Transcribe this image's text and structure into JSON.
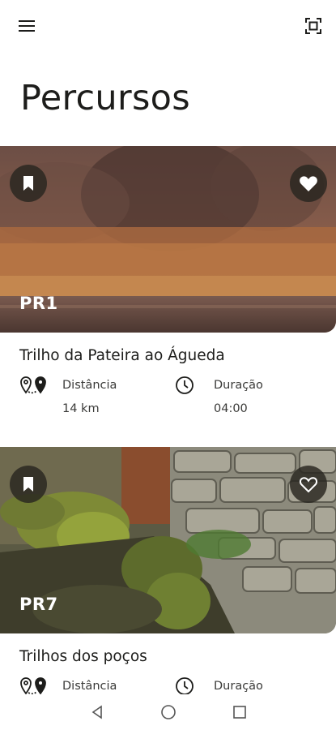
{
  "header": {
    "menu_icon": "hamburger-menu-icon",
    "scan_icon": "scan-frame-icon"
  },
  "page": {
    "title": "Percursos"
  },
  "routes": [
    {
      "code": "PR1",
      "name": "Trilho da Pateira ao Águeda",
      "distance_label": "Distância",
      "distance_value": "14 km",
      "duration_label": "Duração",
      "duration_value": "04:00",
      "favorite": true,
      "image": "wetland-reeds-tree-photo"
    },
    {
      "code": "PR7",
      "name": "Trilhos dos poços",
      "distance_label": "Distância",
      "duration_label": "Duração",
      "favorite": false,
      "image": "mossy-stone-wall-photo"
    }
  ],
  "colors": {
    "text": "#1d1d1b",
    "button_bg": "#28261f",
    "white": "#ffffff"
  },
  "system_nav": {
    "back_icon": "back-triangle-icon",
    "home_icon": "home-circle-icon",
    "recent_icon": "recent-square-icon"
  }
}
